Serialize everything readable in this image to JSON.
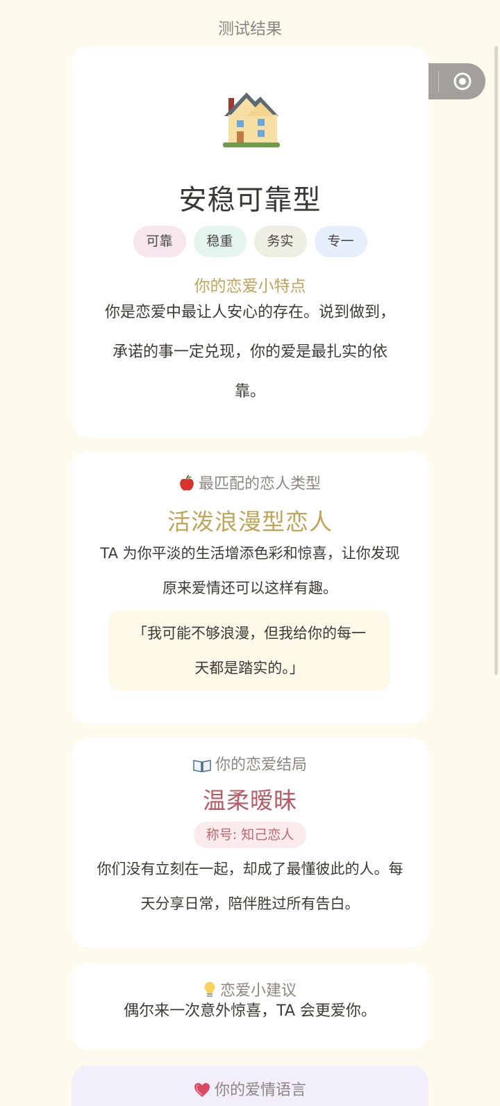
{
  "header": {
    "title": "测试结果"
  },
  "capsule": {
    "more_icon": "more-dots-icon",
    "close_icon": "target-close-icon"
  },
  "result": {
    "icon": "house-icon",
    "title": "安稳可靠型",
    "tags": [
      {
        "label": "可靠",
        "color": "#f8e6ee"
      },
      {
        "label": "稳重",
        "color": "#e4f5ee"
      },
      {
        "label": "务实",
        "color": "#efeee2"
      },
      {
        "label": "专一",
        "color": "#e6effc"
      }
    ],
    "trait_label": "你的恋爱小特点",
    "description": "你是恋爱中最让人安心的存在。说到做到，承诺的事一定兑现，你的爱是最扎实的依靠。"
  },
  "match": {
    "icon": "apple-icon",
    "label": "最匹配的恋人类型",
    "title": "活泼浪漫型恋人",
    "description": "TA 为你平淡的生活增添色彩和惊喜，让你发现原来爱情还可以这样有趣。",
    "quote": "「我可能不够浪漫，但我给你的每一天都是踏实的。」"
  },
  "ending": {
    "icon": "book-icon",
    "label": "你的恋爱结局",
    "title": "温柔暧昧",
    "badge": "称号: 知己恋人",
    "description": "你们没有立刻在一起，却成了最懂彼此的人。每天分享日常，陪伴胜过所有告白。"
  },
  "advice": {
    "icon": "lightbulb-icon",
    "label": "恋爱小建议",
    "text": "偶尔来一次意外惊喜，TA 会更爱你。"
  },
  "love_language": {
    "icon": "heart-icon",
    "label": "你的爱情语言"
  },
  "colors": {
    "accent_gold": "#c0a457",
    "accent_rose": "#b95b66",
    "background": "#fdfaee"
  }
}
